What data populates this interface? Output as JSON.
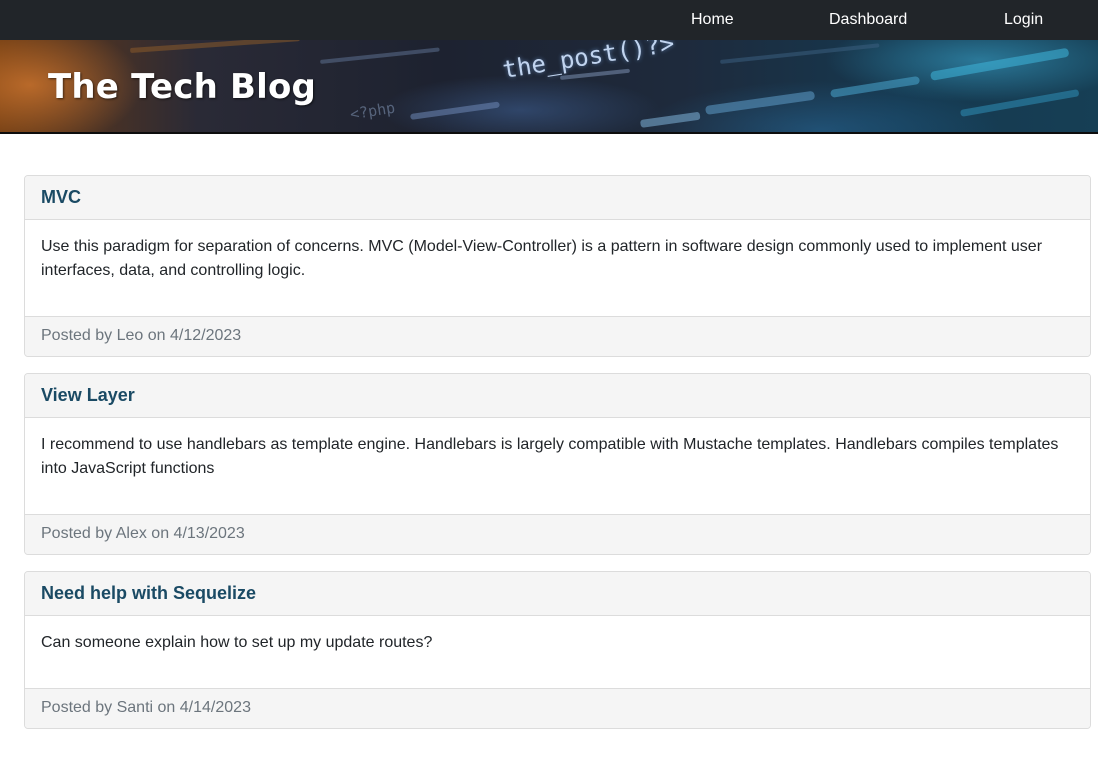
{
  "nav": {
    "home": "Home",
    "dashboard": "Dashboard",
    "login": "Login"
  },
  "banner": {
    "title": "The Tech Blog",
    "code_snippet": "the_post()?>",
    "code_snippet_dim": "<?php",
    "colors": {
      "navbar": "#212529",
      "title_text": "#ffffff",
      "post_title": "#1a4a64"
    }
  },
  "posts": [
    {
      "title": "MVC",
      "body": "Use this paradigm for separation of concerns. MVC (Model-View-Controller) is a pattern in software design commonly used to implement user interfaces, data, and controlling logic.",
      "footer_prefix": "Posted by",
      "author": "Leo",
      "footer_on": "on",
      "date": "4/12/2023"
    },
    {
      "title": "View Layer",
      "body": "I recommend to use handlebars as template engine. Handlebars is largely compatible with Mustache templates. Handlebars compiles templates into JavaScript functions",
      "footer_prefix": "Posted by",
      "author": "Alex",
      "footer_on": "on",
      "date": "4/13/2023"
    },
    {
      "title": "Need help with Sequelize",
      "body": "Can someone explain how to set up my update routes?",
      "footer_prefix": "Posted by",
      "author": "Santi",
      "footer_on": "on",
      "date": "4/14/2023"
    }
  ]
}
